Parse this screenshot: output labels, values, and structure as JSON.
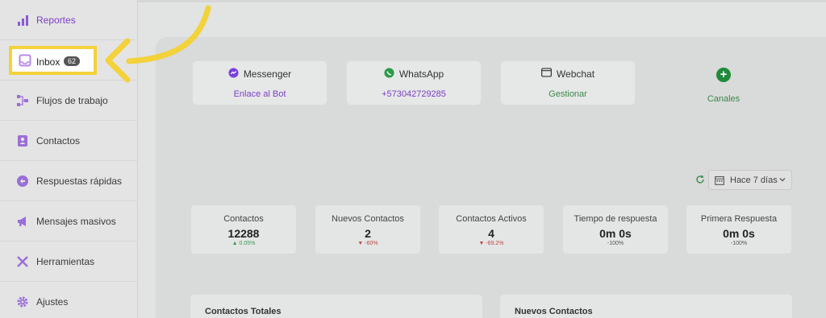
{
  "sidebar": {
    "items": [
      {
        "label": "Reportes",
        "icon": "bar-chart-icon"
      },
      {
        "label": "Inbox",
        "icon": "inbox-icon",
        "badge": "62"
      },
      {
        "label": "Flujos de trabajo",
        "icon": "workflow-icon"
      },
      {
        "label": "Contactos",
        "icon": "contacts-icon"
      },
      {
        "label": "Respuestas rápidas",
        "icon": "quick-reply-icon"
      },
      {
        "label": "Mensajes masivos",
        "icon": "megaphone-icon"
      },
      {
        "label": "Herramientas",
        "icon": "tools-icon"
      },
      {
        "label": "Ajustes",
        "icon": "gear-icon"
      }
    ]
  },
  "channels": [
    {
      "name": "Messenger",
      "action": "Enlace al Bot",
      "icon": "messenger-icon",
      "color": "#7b3fc4"
    },
    {
      "name": "WhatsApp",
      "action": "+573042729285",
      "icon": "whatsapp-icon",
      "color": "#7b3fc4"
    },
    {
      "name": "Webchat",
      "action": "Gestionar",
      "icon": "webchat-icon",
      "color": "#3b8a4a"
    }
  ],
  "add_channel": {
    "label": "Canales",
    "icon": "plus-icon"
  },
  "date_filter": {
    "value": "Hace 7 días"
  },
  "stats": [
    {
      "title": "Contactos",
      "value": "12288",
      "change": "0.05%",
      "trend": "up"
    },
    {
      "title": "Nuevos Contactos",
      "value": "2",
      "change": "-60%",
      "trend": "down"
    },
    {
      "title": "Contactos Activos",
      "value": "4",
      "change": "-69.2%",
      "trend": "down"
    },
    {
      "title": "Tiempo de respuesta",
      "value": "0m 0s",
      "change": "-100%",
      "trend": "neutral"
    },
    {
      "title": "Primera Respuesta",
      "value": "0m 0s",
      "change": "-100%",
      "trend": "neutral"
    }
  ],
  "sections": [
    {
      "title": "Contactos Totales"
    },
    {
      "title": "Nuevos Contactos"
    }
  ],
  "colors": {
    "accent": "#7b3fc4",
    "highlight": "#f3d23a",
    "green": "#1f8a3a"
  }
}
